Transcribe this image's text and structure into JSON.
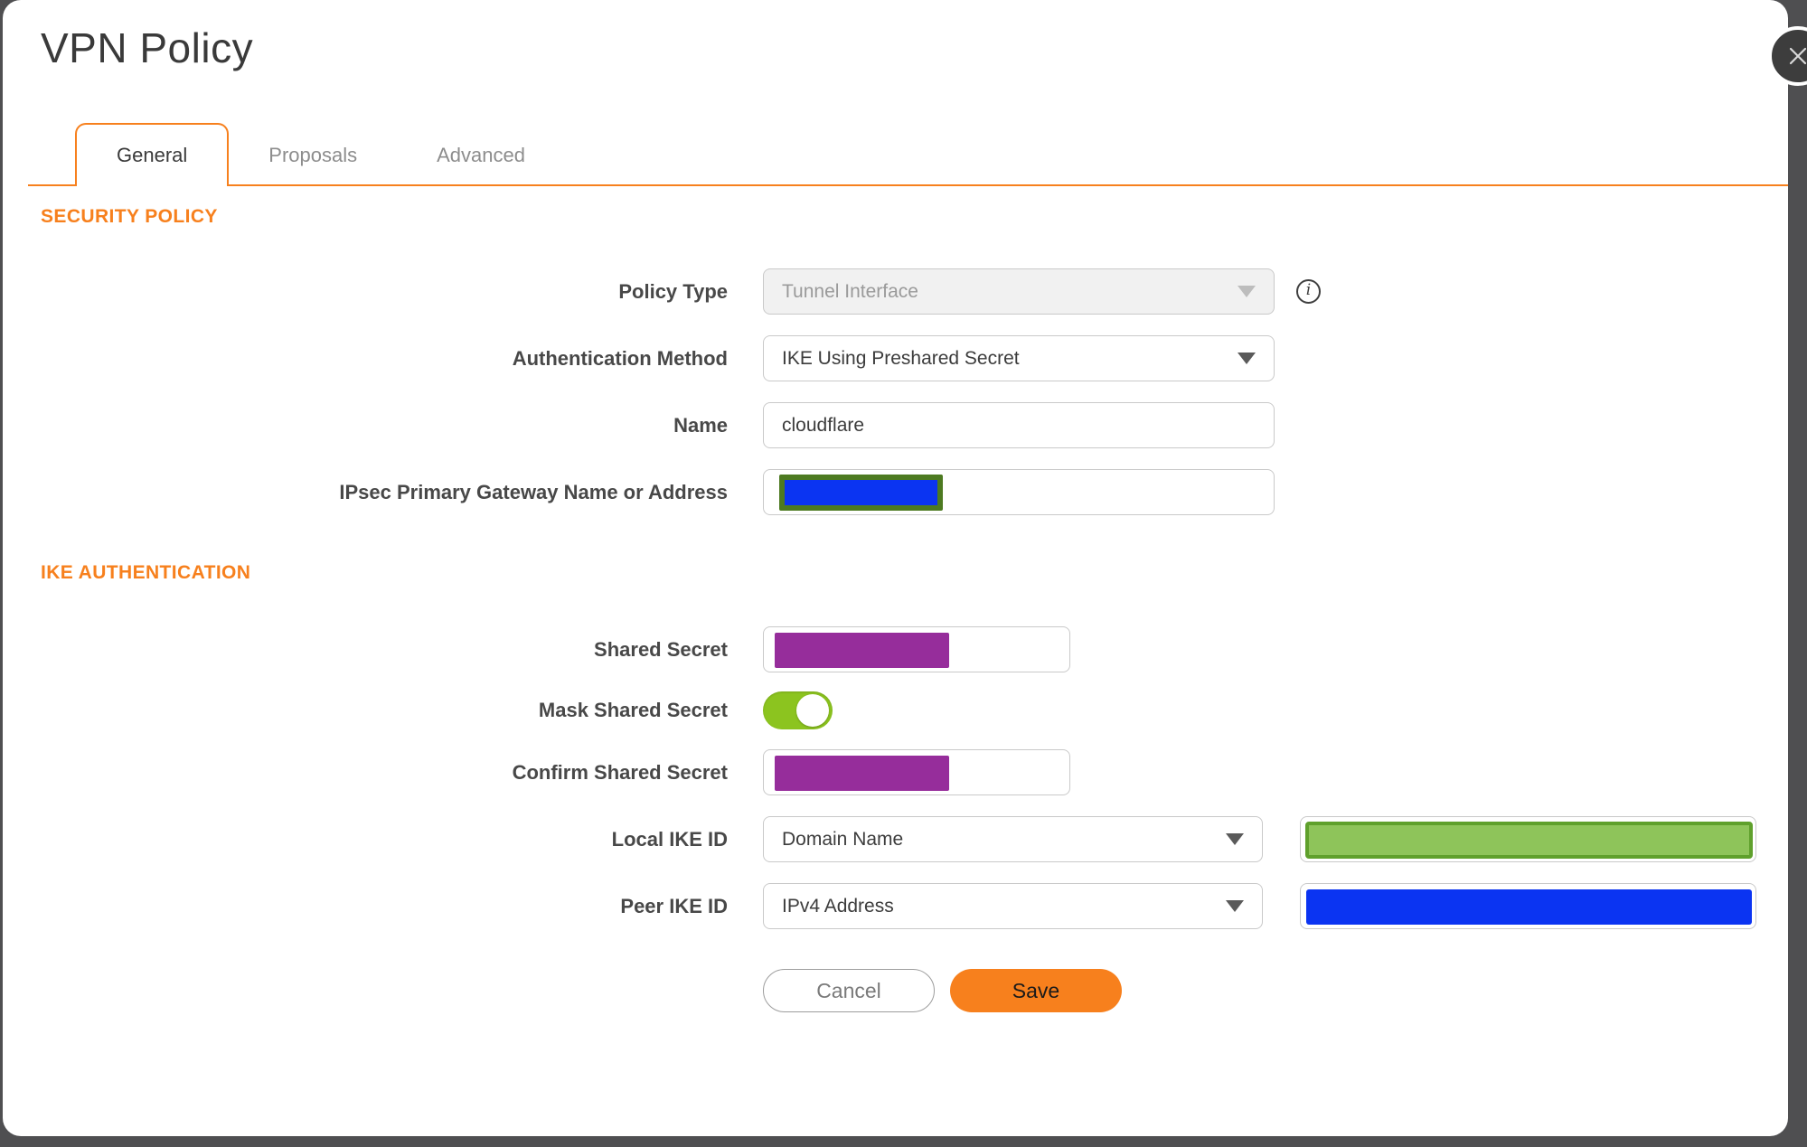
{
  "dialog": {
    "title": "VPN Policy"
  },
  "tabs": [
    {
      "label": "General",
      "active": true
    },
    {
      "label": "Proposals",
      "active": false
    },
    {
      "label": "Advanced",
      "active": false
    }
  ],
  "sections": [
    {
      "heading": "SECURITY POLICY"
    },
    {
      "heading": "IKE AUTHENTICATION"
    }
  ],
  "fields": {
    "policy_type": {
      "label": "Policy Type",
      "value": "Tunnel Interface",
      "disabled": true
    },
    "authentication_method": {
      "label": "Authentication Method",
      "value": "IKE Using Preshared Secret"
    },
    "name": {
      "label": "Name",
      "value": "cloudflare"
    },
    "ipsec_gateway": {
      "label": "IPsec Primary Gateway Name or Address",
      "value_redacted": true
    },
    "shared_secret": {
      "label": "Shared Secret",
      "value_redacted": true
    },
    "mask_shared_secret": {
      "label": "Mask Shared Secret",
      "state": "on"
    },
    "confirm_shared_secret": {
      "label": "Confirm Shared Secret",
      "value_redacted": true
    },
    "local_ike_id": {
      "label": "Local IKE ID",
      "value": "Domain Name",
      "id_value_redacted": true
    },
    "peer_ike_id": {
      "label": "Peer IKE ID",
      "value": "IPv4 Address",
      "id_value_redacted": true
    }
  },
  "buttons": {
    "cancel": "Cancel",
    "save": "Save"
  },
  "colors": {
    "accent_orange": "#F7801D",
    "toggle_on_green": "#8CC41F",
    "redaction_purple": "#962D9B",
    "redaction_blue": "#0B34F2",
    "redaction_green_fill": "#8EC45A",
    "redaction_green_border": "#5FA02C",
    "redaction_olive_border": "#4D7A21"
  }
}
